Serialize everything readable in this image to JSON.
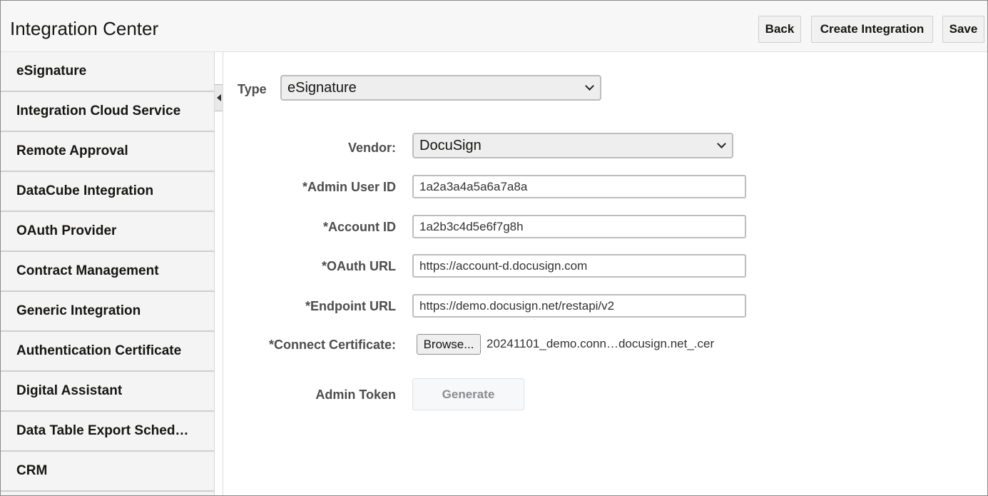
{
  "header": {
    "title": "Integration Center",
    "buttons": {
      "back": "Back",
      "create": "Create Integration",
      "save": "Save"
    }
  },
  "sidebar": {
    "items": [
      {
        "label": "eSignature"
      },
      {
        "label": "Integration Cloud Service"
      },
      {
        "label": "Remote Approval"
      },
      {
        "label": "DataCube Integration"
      },
      {
        "label": "OAuth Provider"
      },
      {
        "label": "Contract Management"
      },
      {
        "label": "Generic Integration"
      },
      {
        "label": "Authentication Certificate"
      },
      {
        "label": "Digital Assistant"
      },
      {
        "label": "Data Table Export Sched…"
      },
      {
        "label": "CRM"
      }
    ]
  },
  "form": {
    "type": {
      "label": "Type",
      "value": "eSignature"
    },
    "vendor": {
      "label": "Vendor:",
      "value": "DocuSign"
    },
    "admin_user_id": {
      "label": "*Admin User ID",
      "value": "1a2a3a4a5a6a7a8a"
    },
    "account_id": {
      "label": "*Account ID",
      "value": "1a2b3c4d5e6f7g8h"
    },
    "oauth_url": {
      "label": "*OAuth URL",
      "value": "https://account-d.docusign.com"
    },
    "endpoint_url": {
      "label": "*Endpoint URL",
      "value": "https://demo.docusign.net/restapi/v2"
    },
    "connect_certificate": {
      "label": "*Connect Certificate:",
      "browse_label": "Browse...",
      "file_name": "20241101_demo.conn…docusign.net_.cer"
    },
    "admin_token": {
      "label": "Admin Token",
      "button_label": "Generate"
    }
  },
  "colors": {
    "header_bg": "#f7f7f7",
    "sidebar_bg": "#f4f4f4",
    "disabled_text": "#8a8d8f"
  }
}
